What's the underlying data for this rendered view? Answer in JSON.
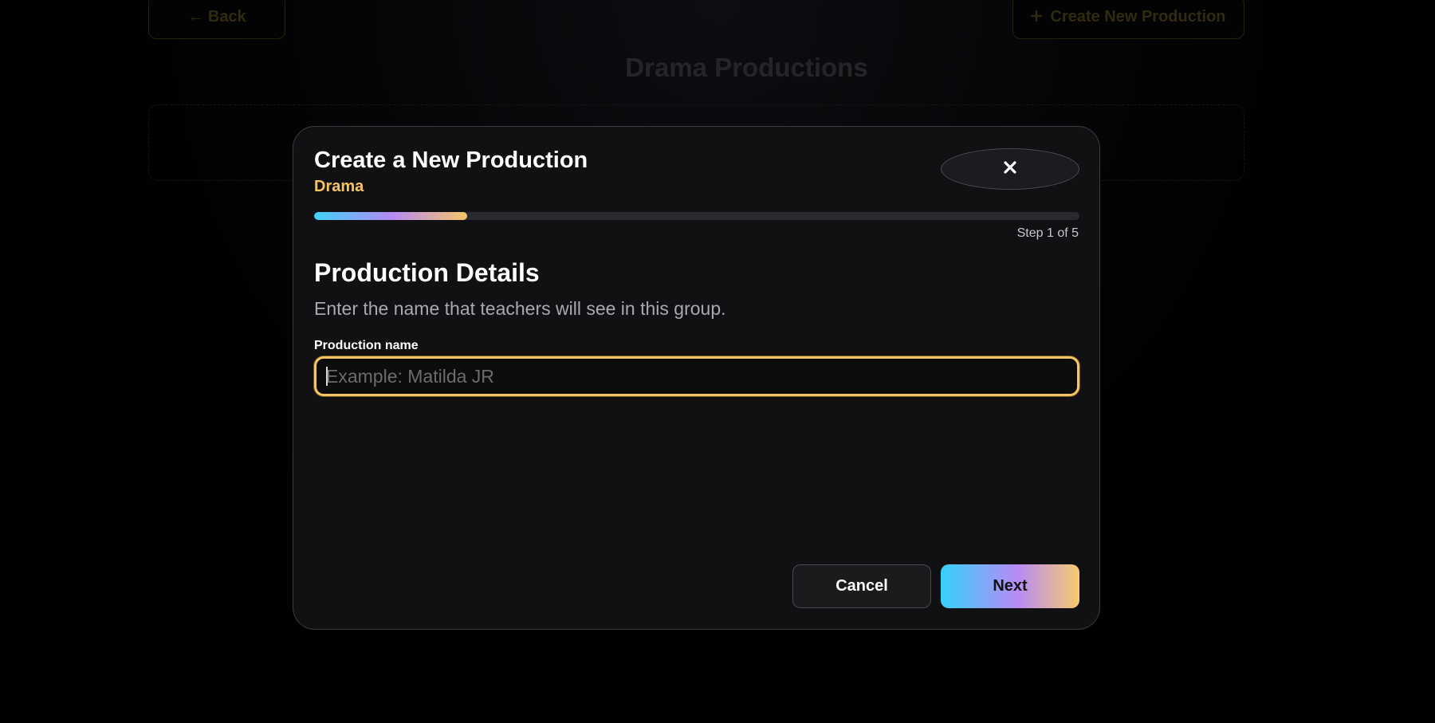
{
  "background": {
    "back_button": "← Back",
    "create_button_icon": "plus-icon",
    "create_button_label": "Create New Production",
    "page_title": "Drama Productions"
  },
  "modal": {
    "title": "Create a New Production",
    "subtitle": "Drama",
    "close_icon": "close-icon",
    "progress": {
      "current_step": 1,
      "total_steps": 5,
      "fraction": 0.2
    },
    "step_label": "Step 1 of 5",
    "section_title": "Production Details",
    "section_description": "Enter the name that teachers will see in this group.",
    "field": {
      "label": "Production name",
      "value": "",
      "placeholder": "Example: Matilda JR"
    },
    "cancel_label": "Cancel",
    "next_label": "Next"
  },
  "colors": {
    "accent": "#f5c45e",
    "gradient_start": "#34d2f8",
    "gradient_mid": "#b68bf6",
    "gradient_end": "#f8ca6e"
  }
}
